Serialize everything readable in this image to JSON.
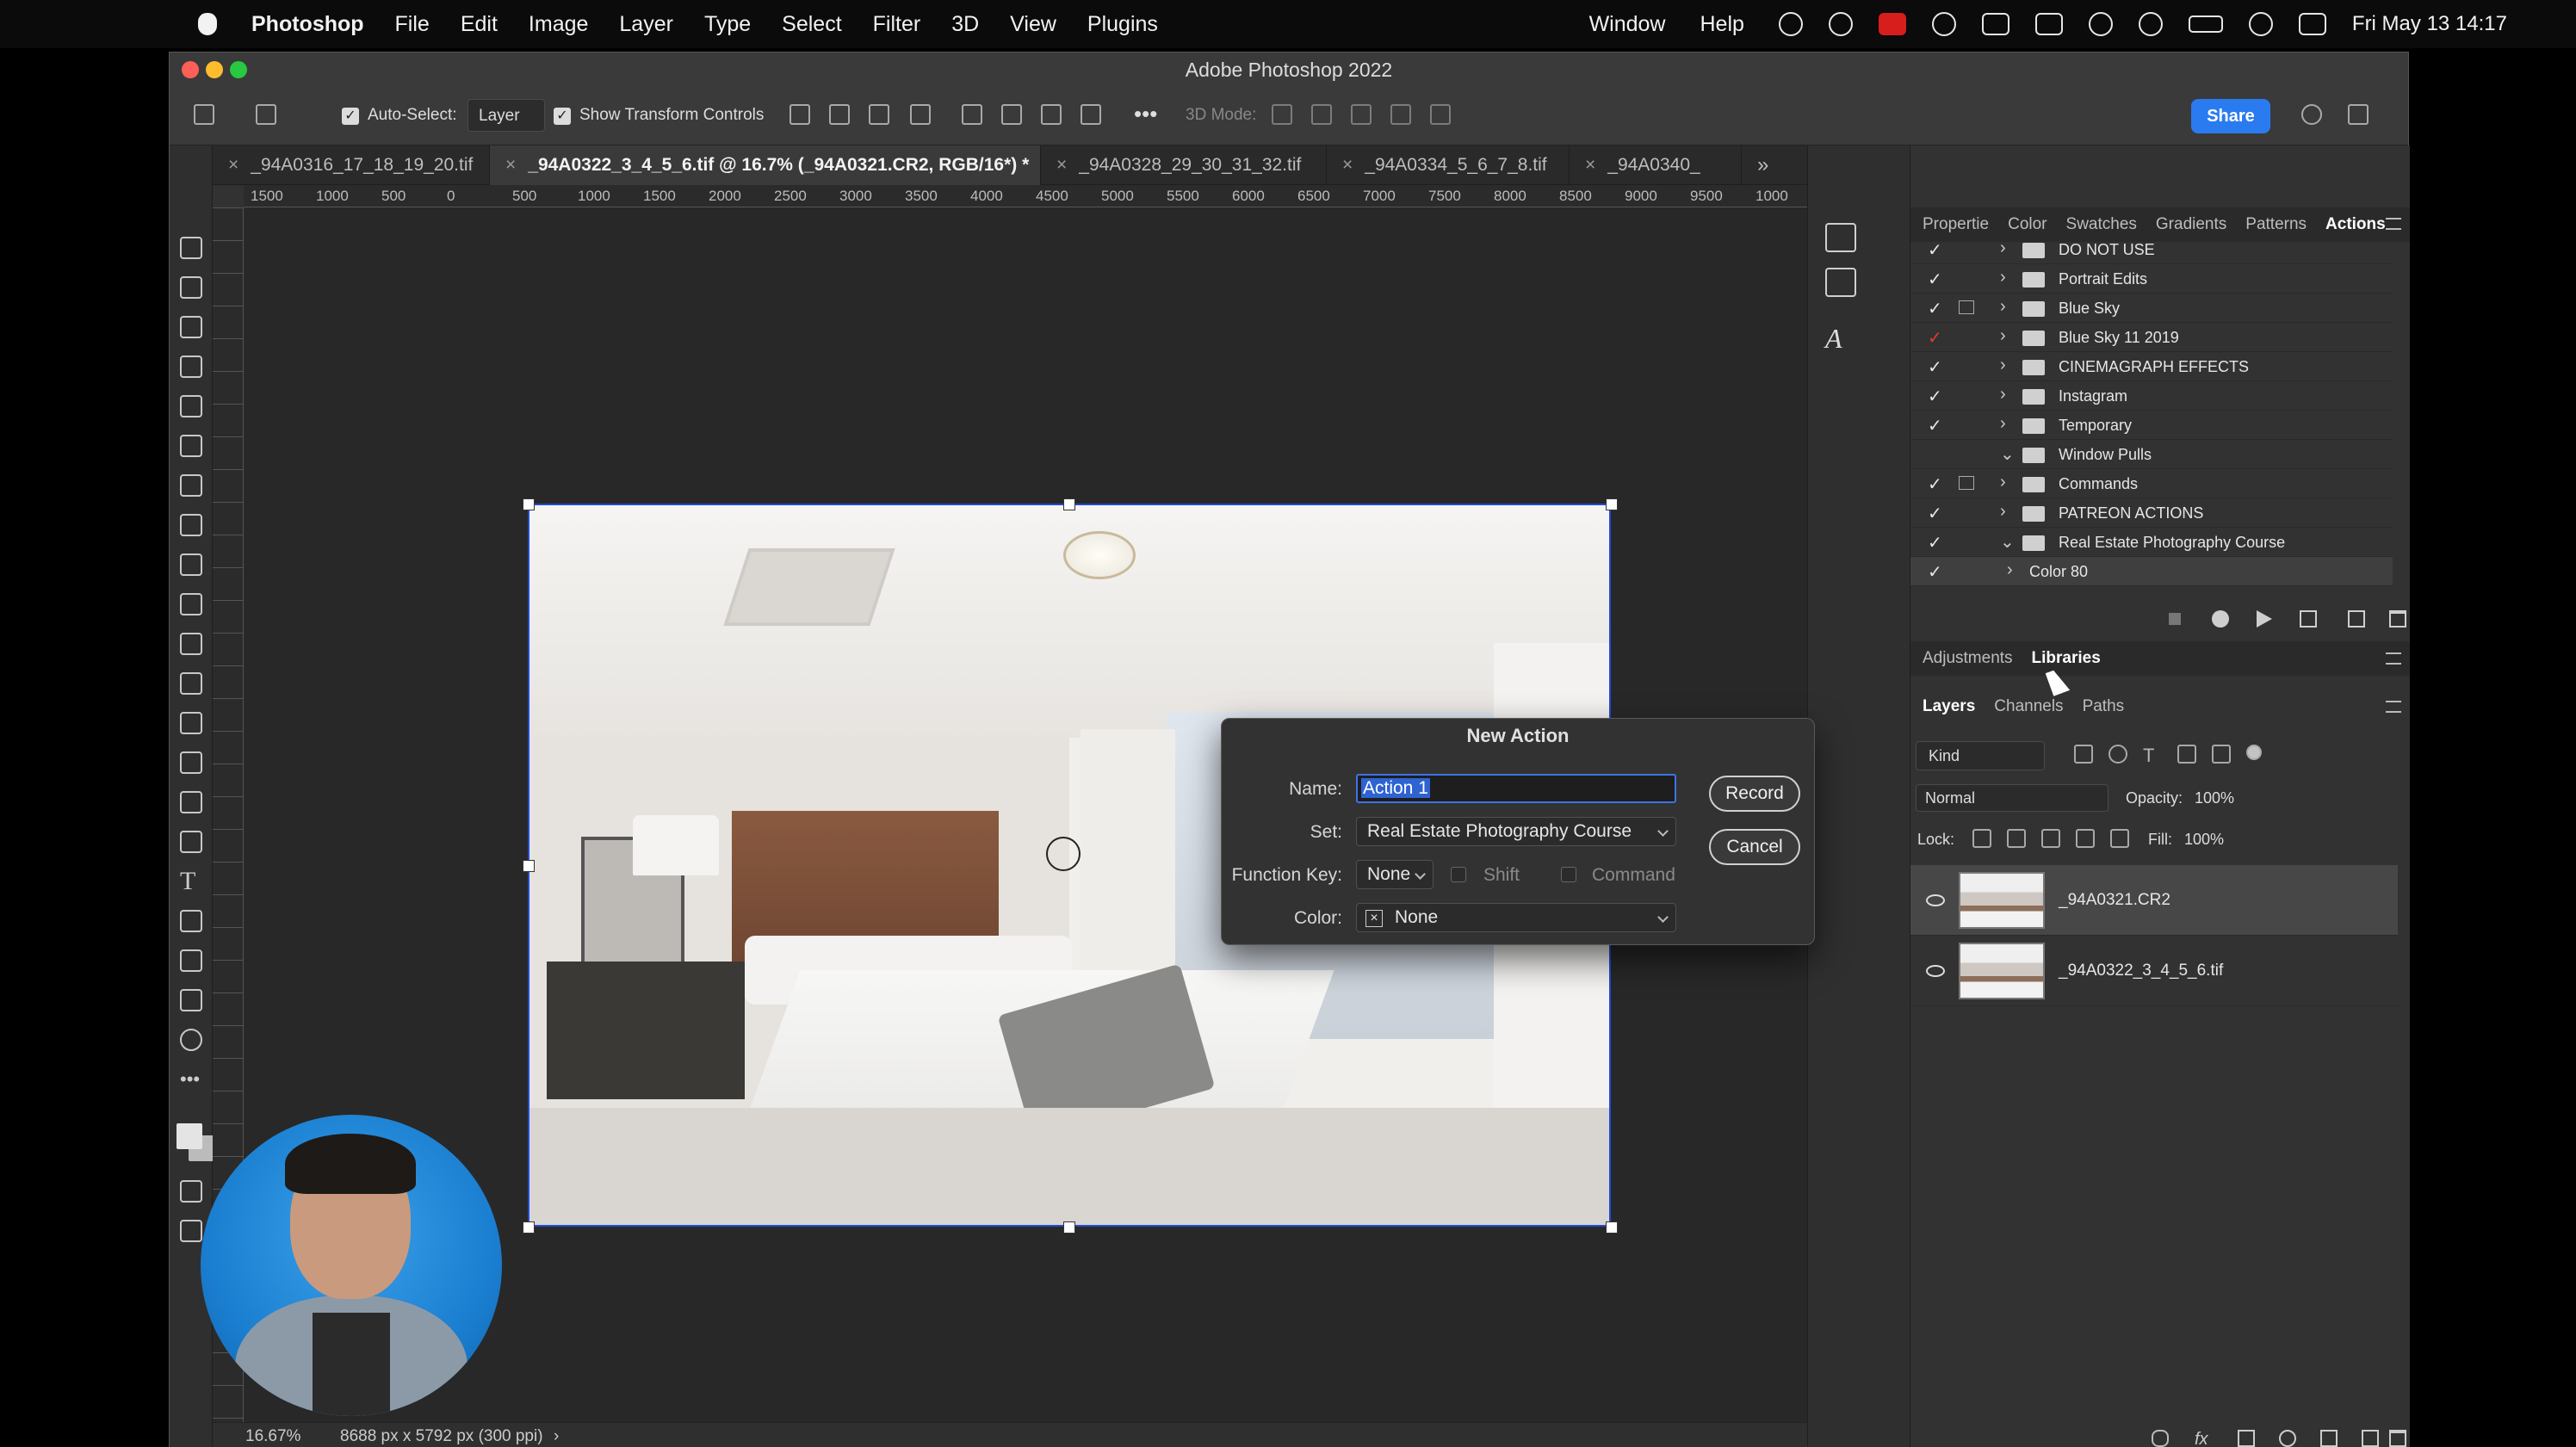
{
  "menubar": {
    "app_name": "Photoshop",
    "menus": [
      "File",
      "Edit",
      "Image",
      "Layer",
      "Type",
      "Select",
      "Filter",
      "3D",
      "View",
      "Plugins"
    ],
    "right_menus": [
      "Window",
      "Help"
    ],
    "clock": "Fri May 13  14:17"
  },
  "window": {
    "title": "Adobe Photoshop 2022"
  },
  "options_bar": {
    "auto_select_label": "Auto-Select:",
    "auto_select_target": "Layer",
    "show_transform_label": "Show Transform Controls",
    "mode_3d_label": "3D Mode:",
    "share_label": "Share"
  },
  "tabs": [
    {
      "label": "_94A0316_17_18_19_20.tif"
    },
    {
      "label": "_94A0322_3_4_5_6.tif @ 16.7% (_94A0321.CR2, RGB/16*) *"
    },
    {
      "label": "_94A0328_29_30_31_32.tif"
    },
    {
      "label": "_94A0334_5_6_7_8.tif"
    },
    {
      "label": "_94A0340_"
    }
  ],
  "ruler": {
    "ticks": [
      "1500",
      "1000",
      "500",
      "0",
      "500",
      "1000",
      "1500",
      "2000",
      "2500",
      "3000",
      "3500",
      "4000",
      "4500",
      "5000",
      "5500",
      "6000",
      "6500",
      "7000",
      "7500",
      "8000",
      "8500",
      "9000",
      "9500",
      "1000"
    ]
  },
  "status": {
    "zoom": "16.67%",
    "doc_info": "8688 px x 5792 px (300 ppi)"
  },
  "panels": {
    "top_tabs": [
      "Propertie",
      "Color",
      "Swatches",
      "Gradients",
      "Patterns",
      "Actions"
    ],
    "actions": [
      {
        "label": "DO NOT USE",
        "check_color": "#e6e6e6"
      },
      {
        "label": "Portrait Edits"
      },
      {
        "label": "Blue Sky"
      },
      {
        "label": "Blue Sky 11 2019"
      },
      {
        "label": "CINEMAGRAPH EFFECTS"
      },
      {
        "label": "Instagram"
      },
      {
        "label": "Temporary"
      },
      {
        "label": "Window Pulls"
      },
      {
        "label": "Commands"
      },
      {
        "label": "PATREON ACTIONS"
      },
      {
        "label": "Real Estate Photography Course"
      },
      {
        "label": "Color 80"
      }
    ],
    "mid_tabs": [
      "Adjustments",
      "Libraries"
    ],
    "layer_tabs": [
      "Layers",
      "Channels",
      "Paths"
    ],
    "kind_label": "Kind",
    "blend_mode": "Normal",
    "opacity_label": "Opacity:",
    "opacity_value": "100%",
    "lock_label": "Lock:",
    "fill_label": "Fill:",
    "fill_value": "100%",
    "layers": [
      {
        "name": "_94A0321.CR2"
      },
      {
        "name": "_94A0322_3_4_5_6.tif"
      }
    ]
  },
  "dialog": {
    "title": "New Action",
    "name_label": "Name:",
    "name_value": "Action 1",
    "set_label": "Set:",
    "set_value": "Real Estate Photography Course",
    "function_key_label": "Function Key:",
    "function_key_value": "None",
    "shift_label": "Shift",
    "command_label": "Command",
    "color_label": "Color:",
    "color_value": "None",
    "record_label": "Record",
    "cancel_label": "Cancel"
  },
  "colors": {
    "selection_blue": "#1f4bd6",
    "share_blue": "#2b7bf0",
    "accent_red": "#e03a3a"
  }
}
